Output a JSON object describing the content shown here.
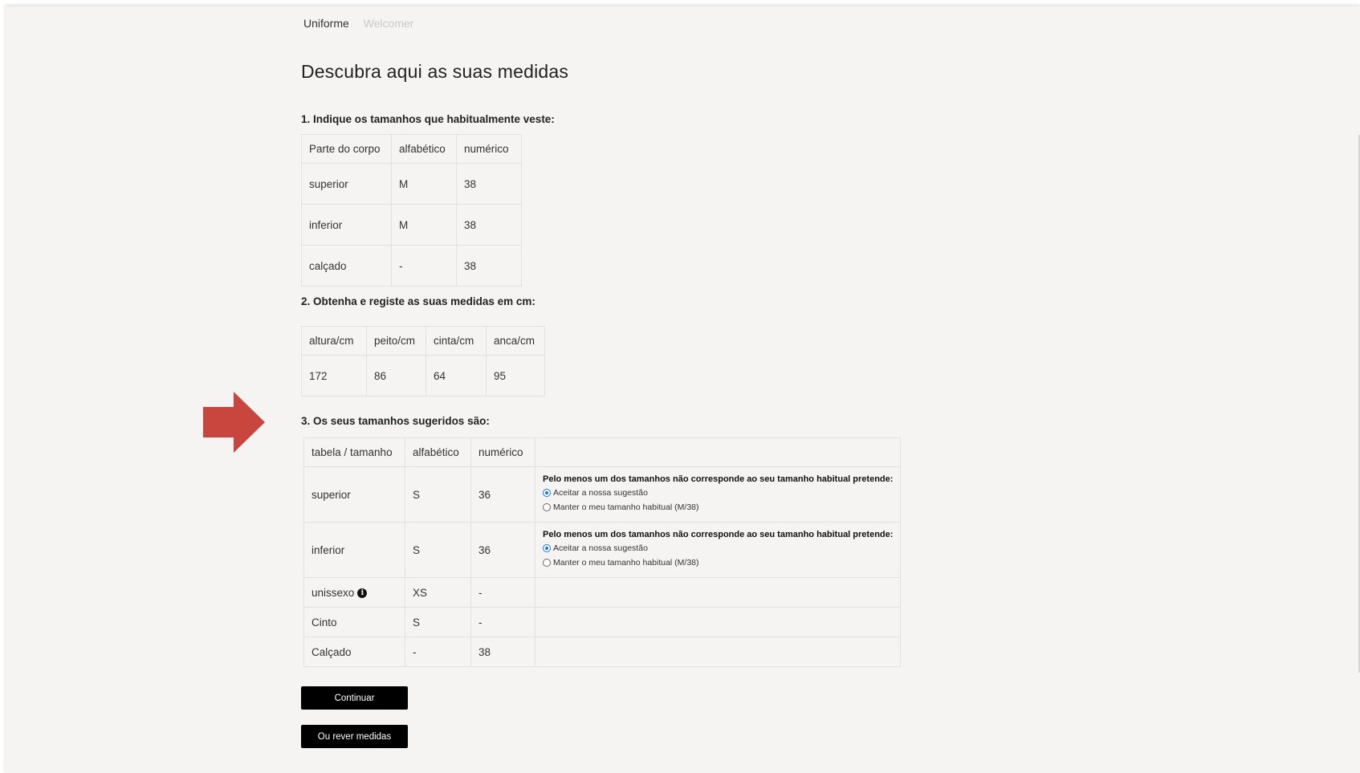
{
  "breadcrumb": [
    "Uniforme",
    "Welcomer"
  ],
  "page_title": "Descubra aqui as suas medidas",
  "section1": {
    "title": "1. Indique os tamanhos que habitualmente veste:",
    "headers": [
      "Parte do corpo",
      "alfabético",
      "numérico"
    ],
    "rows": [
      {
        "part": "superior",
        "alpha": "M",
        "num": "38"
      },
      {
        "part": "inferior",
        "alpha": "M",
        "num": "38"
      },
      {
        "part": "calçado",
        "alpha": "-",
        "num": "38"
      }
    ]
  },
  "section2": {
    "title": "2. Obtenha e registe as suas medidas em cm:",
    "headers": [
      "altura/cm",
      "peito/cm",
      "cinta/cm",
      "anca/cm"
    ],
    "values": [
      "172",
      "86",
      "64",
      "95"
    ]
  },
  "section3": {
    "title": "3. Os seus tamanhos sugeridos são:",
    "headers": [
      "tabela / tamanho",
      "alfabético",
      "numérico",
      ""
    ],
    "rows": [
      {
        "part": "superior",
        "alpha": "S",
        "num": "36",
        "notice": "Pelo menos um dos tamanhos não corresponde ao seu tamanho habitual pretende:",
        "option1": "Aceitar a nossa sugestão",
        "option2": "Manter o meu tamanho habitual (M/38)"
      },
      {
        "part": "inferior",
        "alpha": "S",
        "num": "36",
        "notice": "Pelo menos um dos tamanhos não corresponde ao seu tamanho habitual pretende:",
        "option1": "Aceitar a nossa sugestão",
        "option2": "Manter o meu tamanho habitual (M/38)"
      },
      {
        "part": "unissexo",
        "alpha": "XS",
        "num": "-"
      },
      {
        "part": "Cinto",
        "alpha": "S",
        "num": "-"
      },
      {
        "part": "Calçado",
        "alpha": "-",
        "num": "38"
      }
    ]
  },
  "buttons": {
    "continue": "Continuar",
    "review": "Ou rever medidas"
  },
  "icons": {
    "arrow": "arrow-right-icon",
    "info": "info-icon"
  },
  "colors": {
    "arrow": "#c9463f",
    "highlight": "#e23a3a",
    "button": "#000000"
  }
}
